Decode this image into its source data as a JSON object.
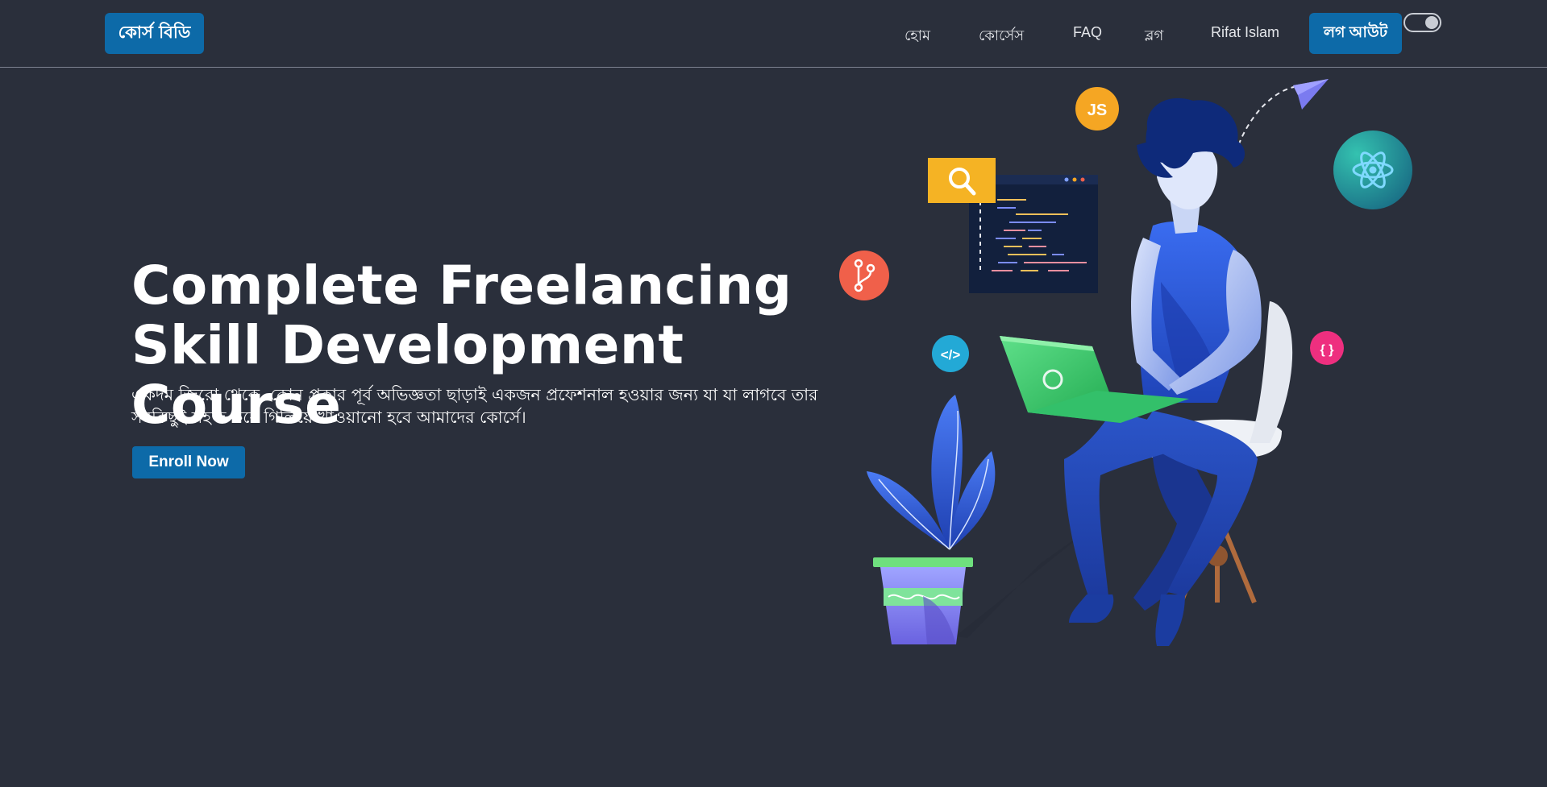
{
  "header": {
    "brand": "কোর্স বিডি",
    "nav": [
      {
        "label": "হোম"
      },
      {
        "label": "কোর্সেস"
      },
      {
        "label": "FAQ"
      },
      {
        "label": "ব্লগ"
      },
      {
        "label": "Rifat Islam"
      }
    ],
    "logout_label": "লগ আউট",
    "theme_toggle": "on"
  },
  "hero": {
    "title_line1": "Complete Freelancing",
    "title_line2": "Skill Development Course",
    "subtitle_line1": "একদম জিরো থেকে, কোন প্রকার পূর্ব অভিজ্ঞতা ছাড়াই একজন প্রফেশনাল হওয়ার জন্য যা যা লাগবে তার",
    "subtitle_line2": "সবকিছুই সহজ করে গিলিয়ে খাওয়ানো হবে আমাদের কোর্সে।",
    "enroll_label": "Enroll Now"
  },
  "illustration": {
    "js_badge": "JS",
    "braces_badge": "{ }",
    "code_badge": "</>",
    "colors": {
      "accent": "#0d6aa8",
      "background": "#2a2f3b",
      "js": "#f5a623",
      "git": "#f0604a",
      "react": "#2aa6a0",
      "laptop": "#3ec66b",
      "shirt": "#2f5fd8"
    }
  }
}
